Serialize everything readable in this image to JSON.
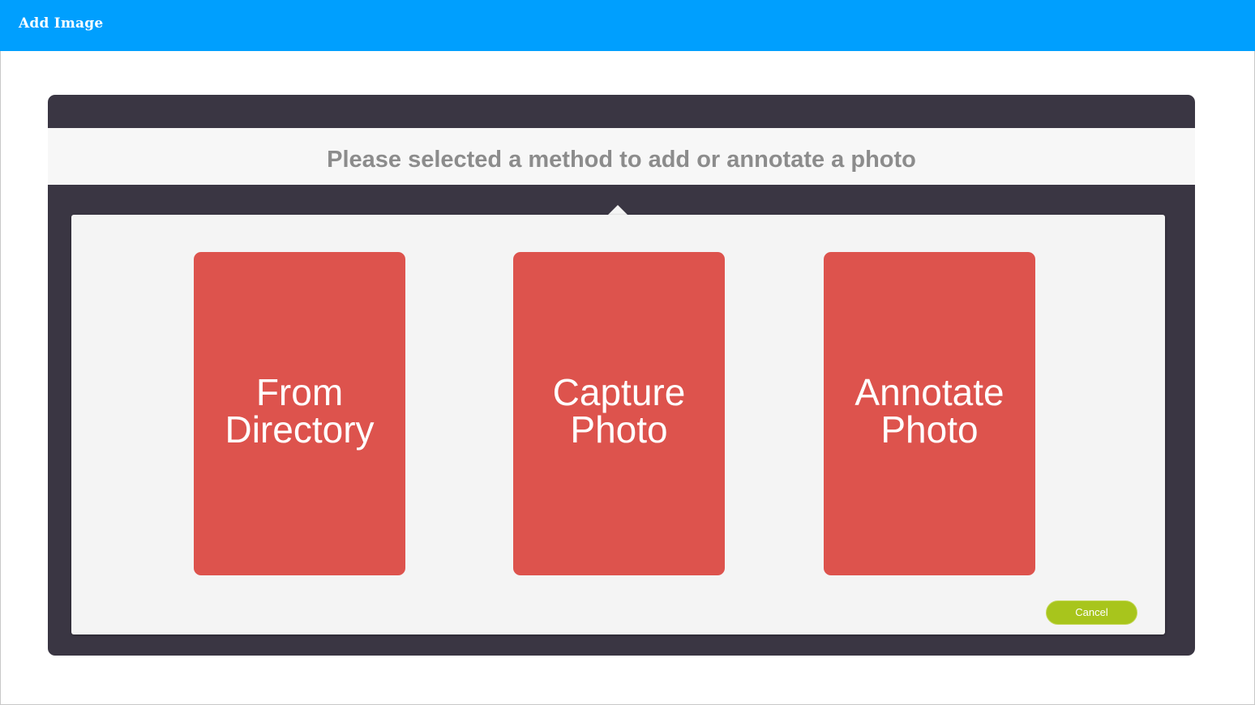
{
  "window": {
    "title": "Add Image"
  },
  "dialog": {
    "heading": "Please selected a method to add or annotate a photo",
    "options": [
      {
        "label": "From\nDirectory"
      },
      {
        "label": "Capture\nPhoto"
      },
      {
        "label": "Annotate\nPhoto"
      }
    ],
    "cancel_label": "Cancel"
  },
  "colors": {
    "title_bar": "#009ffe",
    "dialog_frame": "#3a3643",
    "card": "#dd534d",
    "cancel_button": "#a8c51c",
    "heading_text": "#8c8c8c"
  }
}
